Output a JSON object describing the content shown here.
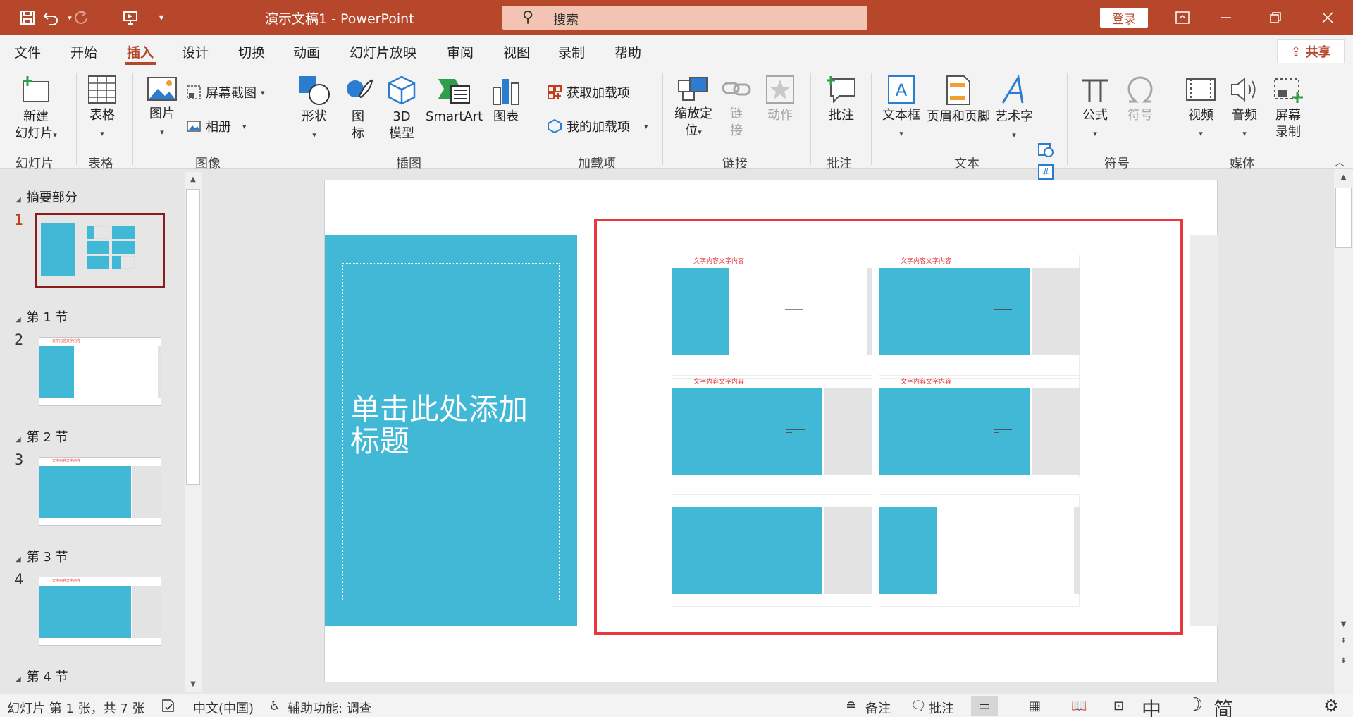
{
  "titlebar": {
    "doc_title": "演示文稿1  -  PowerPoint",
    "search_label": "搜索",
    "login_label": "登录"
  },
  "tabs": [
    "文件",
    "开始",
    "插入",
    "设计",
    "切换",
    "动画",
    "幻灯片放映",
    "审阅",
    "视图",
    "录制",
    "帮助"
  ],
  "active_tab": "插入",
  "share_label": "共享",
  "ribbon": {
    "new_slide": "新建\n幻灯片",
    "table": "表格",
    "picture": "图片",
    "screenshot": "屏幕截图",
    "album": "相册",
    "shapes": "形状",
    "icons": "图\n标",
    "model3d": "3D\n模型",
    "smartart": "SmartArt",
    "chart": "图表",
    "get_addins": "获取加载项",
    "my_addins": "我的加载项",
    "zoom": "缩放定\n位",
    "link": "链\n接",
    "action": "动作",
    "comment": "批注",
    "textbox": "文本框",
    "header_footer": "页眉和页脚",
    "wordart": "艺术字",
    "equation": "公式",
    "symbol": "符号",
    "video": "视频",
    "audio": "音频",
    "screen_rec": "屏幕\n录制",
    "groups": [
      "幻灯片",
      "表格",
      "图像",
      "插图",
      "加载项",
      "链接",
      "批注",
      "文本",
      "符号",
      "媒体"
    ]
  },
  "sections": [
    {
      "label": "摘要部分",
      "slide": "1"
    },
    {
      "label": "第 1 节",
      "slide": "2"
    },
    {
      "label": "第 2 节",
      "slide": "3"
    },
    {
      "label": "第 3 节",
      "slide": "4"
    },
    {
      "label": "第 4 节",
      "slide": ""
    }
  ],
  "thumb_header": "文字内容文字内容",
  "slide": {
    "title_placeholder": "单击此处添加\n标题",
    "card_header": "文字内容文字内容"
  },
  "status": {
    "slide_info": "幻灯片 第 1 张，共 7 张",
    "language": "中文(中国)",
    "accessibility": "辅助功能: 调查",
    "notes": "备注",
    "comments": "批注",
    "ime": [
      "中",
      "简"
    ]
  },
  "colors": {
    "accent": "#b7472a",
    "slide_blue": "#41b8d5",
    "highlight": "#e8383d"
  }
}
